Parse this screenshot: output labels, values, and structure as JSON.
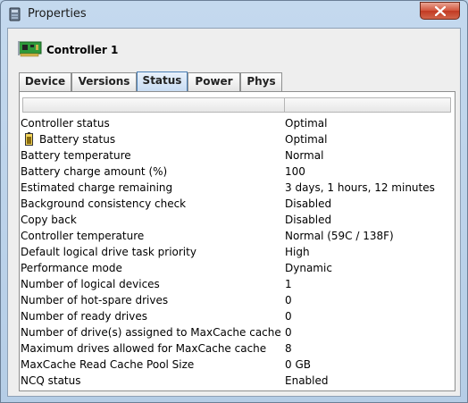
{
  "window": {
    "title": "Properties",
    "app_icon": "properties-app-icon",
    "close_icon": "close-icon"
  },
  "controller": {
    "name": "Controller 1",
    "icon": "controller-card-icon"
  },
  "tabs": [
    {
      "label": "Device"
    },
    {
      "label": "Versions"
    },
    {
      "label": "Status",
      "active": true
    },
    {
      "label": "Power"
    },
    {
      "label": "Phys"
    }
  ],
  "status_rows": [
    {
      "name": "Controller status",
      "value": "Optimal"
    },
    {
      "name": "Battery status",
      "value": "Optimal",
      "icon": "battery-icon"
    },
    {
      "name": "Battery temperature",
      "value": "Normal"
    },
    {
      "name": "Battery charge amount (%)",
      "value": "100"
    },
    {
      "name": "Estimated charge remaining",
      "value": "3 days, 1 hours, 12 minutes"
    },
    {
      "name": "Background consistency check",
      "value": "Disabled"
    },
    {
      "name": "Copy back",
      "value": "Disabled"
    },
    {
      "name": "Controller temperature",
      "value": "Normal (59C / 138F)"
    },
    {
      "name": "Default logical drive task priority",
      "value": "High"
    },
    {
      "name": "Performance mode",
      "value": "Dynamic"
    },
    {
      "name": "Number of logical devices",
      "value": "1"
    },
    {
      "name": "Number of hot-spare drives",
      "value": "0"
    },
    {
      "name": "Number of ready drives",
      "value": "0"
    },
    {
      "name": "Number of drive(s) assigned to MaxCache cache",
      "value": "0"
    },
    {
      "name": "Maximum drives allowed for MaxCache cache",
      "value": "8"
    },
    {
      "name": "MaxCache Read Cache Pool Size",
      "value": "0 GB"
    },
    {
      "name": "NCQ status",
      "value": "Enabled"
    }
  ]
}
